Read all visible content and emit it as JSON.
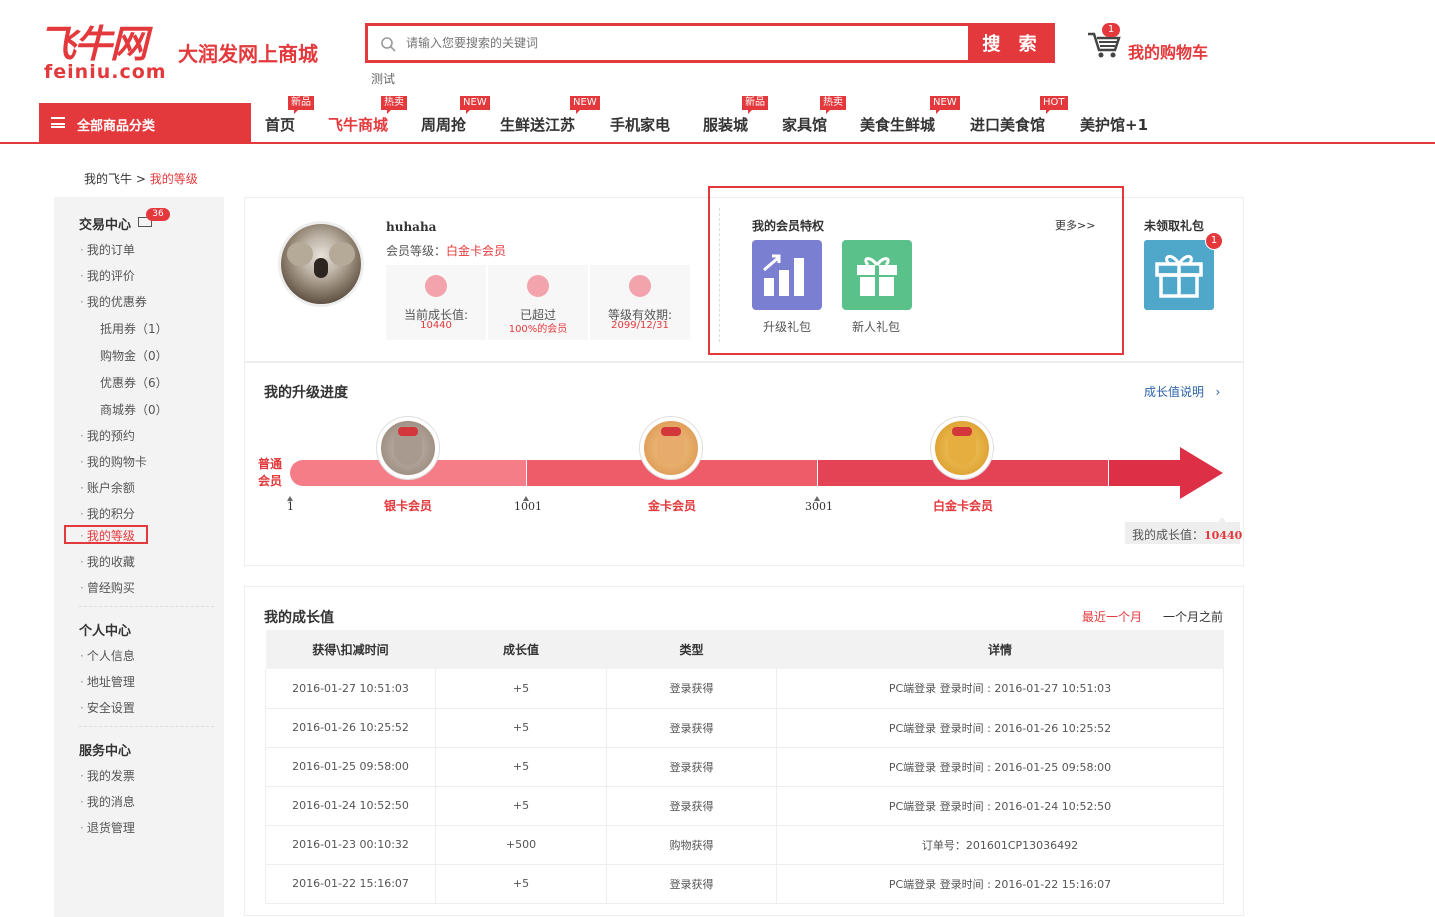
{
  "brand": {
    "logo_main": "飞牛网",
    "logo_sub": "feiniu.com",
    "slogan": "大润发网上商城",
    "accent": "#e4393c"
  },
  "search": {
    "placeholder": "请输入您要搜索的关键词",
    "button": "搜 索",
    "hot_word": "测试"
  },
  "cart": {
    "label": "我的购物车",
    "count": "1",
    "icon": "cart-icon"
  },
  "nav": {
    "category_label": "全部商品分类",
    "items": [
      {
        "label": "首页",
        "tag": "新品"
      },
      {
        "label": "飞牛商城",
        "tag": "热卖"
      },
      {
        "label": "周周抢",
        "tag": "NEW"
      },
      {
        "label": "生鲜送江苏",
        "tag": "NEW"
      },
      {
        "label": "手机家电",
        "tag": ""
      },
      {
        "label": "服装城",
        "tag": "新品"
      },
      {
        "label": "家具馆",
        "tag": "热卖"
      },
      {
        "label": "美食生鲜城",
        "tag": "NEW"
      },
      {
        "label": "进口美食馆",
        "tag": "HOT"
      },
      {
        "label": "美护馆+1",
        "tag": ""
      }
    ]
  },
  "breadcrumb": {
    "root": "我的飞牛",
    "sep": ">",
    "current": "我的等级"
  },
  "sidebar": {
    "trade": {
      "title": "交易中心",
      "badge": "36",
      "items": [
        "我的订单",
        "我的评价",
        "我的优惠券"
      ],
      "coupons": [
        "抵用券（1）",
        "购物金（0）",
        "优惠券（6）",
        "商城券（0）"
      ],
      "more": [
        "我的预约",
        "我的购物卡",
        "账户余额",
        "我的积分",
        "我的等级",
        "我的收藏",
        "曾经购买"
      ]
    },
    "personal": {
      "title": "个人中心",
      "items": [
        "个人信息",
        "地址管理",
        "安全设置"
      ]
    },
    "service": {
      "title": "服务中心",
      "items": [
        "我的发票",
        "我的消息",
        "退货管理"
      ]
    }
  },
  "profile": {
    "username": "huhaha",
    "level_label": "会员等级：",
    "level_value": "白金卡会员",
    "stats": [
      {
        "label": "当前成长值:",
        "value": "10440"
      },
      {
        "label": "已超过",
        "value": "100%的会员"
      },
      {
        "label": "等级有效期:",
        "value": "2099/12/31"
      }
    ]
  },
  "privileges": {
    "title": "我的会员特权",
    "more": "更多>>",
    "gifts": [
      {
        "label": "升级礼包",
        "color": "#7b7fd1"
      },
      {
        "label": "新人礼包",
        "color": "#5bc18b"
      }
    ]
  },
  "unclaimed": {
    "title": "未领取礼包",
    "count": "1"
  },
  "progress": {
    "title": "我的升级进度",
    "help_link": "成长值说明",
    "start_label": "普通会员",
    "ticks": [
      "1",
      "1001",
      "3001"
    ],
    "levels": [
      "银卡会员",
      "金卡会员",
      "白金卡会员"
    ],
    "my_label": "我的成长值：",
    "my_value": "10440"
  },
  "growth": {
    "title": "我的成长值",
    "filter_recent": "最近一个月",
    "filter_older": "一个月之前",
    "columns": [
      "获得\\扣减时间",
      "成长值",
      "类型",
      "详情"
    ],
    "rows": [
      [
        "2016-01-27 10:51:03",
        "+5",
        "登录获得",
        "PC端登录 登录时间 : 2016-01-27 10:51:03"
      ],
      [
        "2016-01-26 10:25:52",
        "+5",
        "登录获得",
        "PC端登录 登录时间 : 2016-01-26 10:25:52"
      ],
      [
        "2016-01-25 09:58:00",
        "+5",
        "登录获得",
        "PC端登录 登录时间 : 2016-01-25 09:58:00"
      ],
      [
        "2016-01-24 10:52:50",
        "+5",
        "登录获得",
        "PC端登录 登录时间 : 2016-01-24 10:52:50"
      ],
      [
        "2016-01-23 00:10:32",
        "+500",
        "购物获得",
        "订单号：201601CP13036492"
      ],
      [
        "2016-01-22 15:16:07",
        "+5",
        "登录获得",
        "PC端登录 登录时间 : 2016-01-22 15:16:07"
      ]
    ]
  }
}
